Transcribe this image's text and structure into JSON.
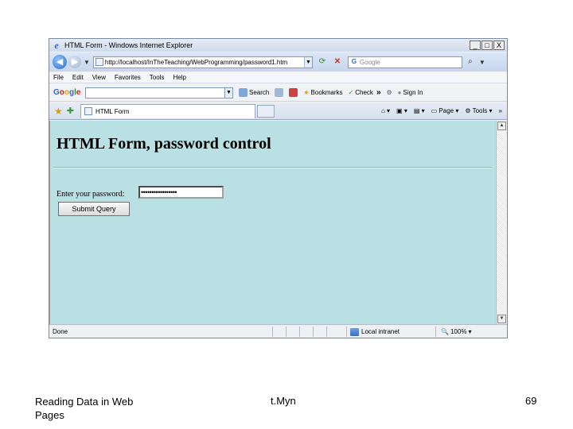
{
  "window": {
    "title": "HTML Form - Windows Internet Explorer",
    "minimize": "_",
    "maximize": "□",
    "close": "X"
  },
  "addressbar": {
    "url": "http://localhost/InTheTeaching/WebProgramming/password1.htm",
    "search_placeholder": "Google"
  },
  "menu": [
    "File",
    "Edit",
    "View",
    "Favorites",
    "Tools",
    "Help"
  ],
  "google_toolbar": {
    "logo": "Google",
    "search_label": "Search",
    "bookmarks_label": "Bookmarks",
    "check_label": "Check",
    "signin_label": "Sign In"
  },
  "tabs": {
    "active_label": "HTML Form",
    "page_label": "Page",
    "tools_label": "Tools"
  },
  "page": {
    "heading": "HTML Form, password control",
    "password_label": "Enter your password:",
    "password_value": "•••••••••••••••••",
    "submit_label": "Submit Query"
  },
  "status": {
    "text": "Done",
    "zone": "Local intranet",
    "zoom": "100%"
  },
  "footer": {
    "left": "Reading Data in Web Pages",
    "center": "t.Myn",
    "page_number": "69"
  }
}
